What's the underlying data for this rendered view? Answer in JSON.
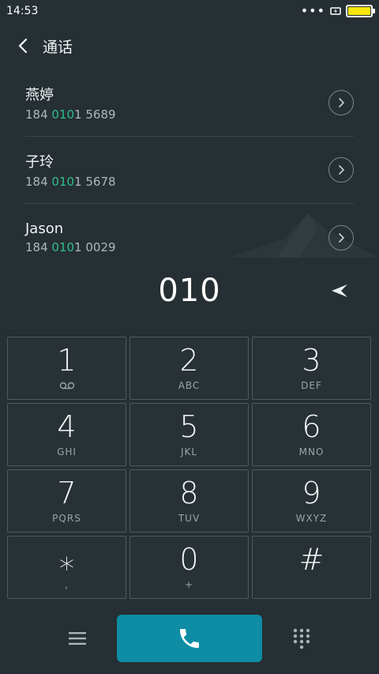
{
  "status_bar": {
    "time": "14:53",
    "dots": "•••"
  },
  "header": {
    "title": "通话"
  },
  "contacts": [
    {
      "name": "燕婷",
      "number_prefix": "184 ",
      "number_match": "010",
      "number_suffix": "1 5689"
    },
    {
      "name": "子玲",
      "number_prefix": "184 ",
      "number_match": "010",
      "number_suffix": "1 5678"
    },
    {
      "name": "Jason",
      "number_prefix": "184 ",
      "number_match": "010",
      "number_suffix": "1 0029"
    }
  ],
  "dialer": {
    "input_value": "010"
  },
  "keypad": [
    {
      "digit": "1",
      "letters": "",
      "icon": "voicemail-icon"
    },
    {
      "digit": "2",
      "letters": "ABC"
    },
    {
      "digit": "3",
      "letters": "DEF"
    },
    {
      "digit": "4",
      "letters": "GHI"
    },
    {
      "digit": "5",
      "letters": "JKL"
    },
    {
      "digit": "6",
      "letters": "MNO"
    },
    {
      "digit": "7",
      "letters": "PQRS"
    },
    {
      "digit": "8",
      "letters": "TUV"
    },
    {
      "digit": "9",
      "letters": "WXYZ"
    },
    {
      "digit": "⁎",
      "letters": ","
    },
    {
      "digit": "0",
      "letters": "+"
    },
    {
      "digit": "#",
      "letters": ""
    }
  ],
  "colors": {
    "background": "#262f33",
    "match_highlight": "#2fbf8a",
    "call_button": "#0e8da5",
    "battery_fill": "#f5e60c"
  }
}
